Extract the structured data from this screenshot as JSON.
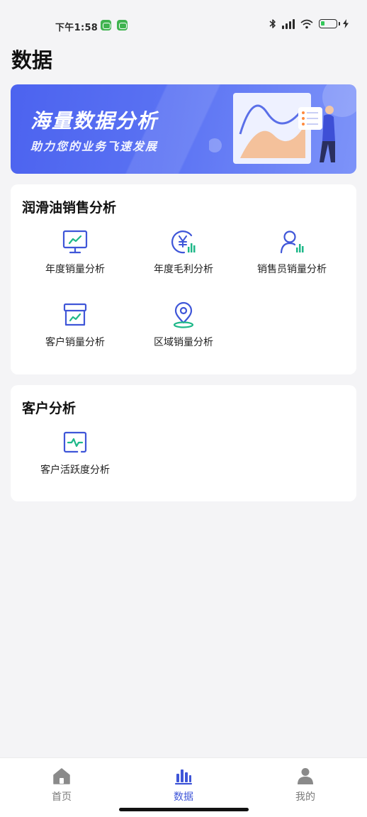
{
  "status_bar": {
    "time": "下午1:58",
    "icons": [
      "notification-app-icon",
      "notification-app-icon",
      "bluetooth-icon",
      "signal-icon",
      "wifi-icon",
      "battery-icon",
      "charging-icon"
    ]
  },
  "page": {
    "title": "数据"
  },
  "banner": {
    "title": "海量数据分析",
    "subtitle": "助力您的业务飞速发展"
  },
  "sections": [
    {
      "title": "润滑油销售分析",
      "items": [
        {
          "label": "年度销量分析",
          "icon": "monitor-chart-icon"
        },
        {
          "label": "年度毛利分析",
          "icon": "yen-chart-icon"
        },
        {
          "label": "销售员销量分析",
          "icon": "person-chart-icon"
        },
        {
          "label": "客户销量分析",
          "icon": "box-chart-icon"
        },
        {
          "label": "区域销量分析",
          "icon": "location-pin-icon"
        }
      ]
    },
    {
      "title": "客户分析",
      "items": [
        {
          "label": "客户活跃度分析",
          "icon": "pulse-screen-icon"
        }
      ]
    }
  ],
  "tabbar": {
    "active": "数据",
    "tabs": [
      {
        "label": "首页",
        "icon": "home-icon"
      },
      {
        "label": "数据",
        "icon": "bar-chart-icon"
      },
      {
        "label": "我的",
        "icon": "user-icon"
      }
    ]
  },
  "colors": {
    "accent": "#3f56d8",
    "icon_green": "#1fb889",
    "banner_start": "#4c63ef",
    "banner_end": "#7d93f9"
  }
}
